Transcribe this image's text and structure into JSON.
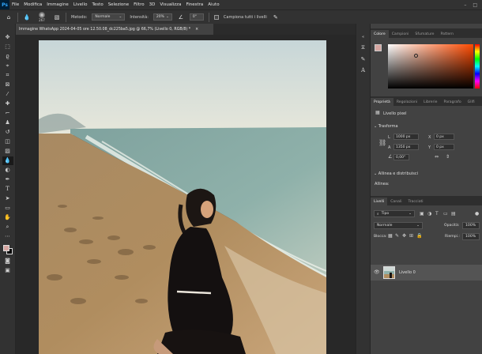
{
  "app": {
    "logo": "Ps",
    "window_buttons": [
      "–",
      "□"
    ]
  },
  "menu": [
    "File",
    "Modifica",
    "Immagine",
    "Livello",
    "Testo",
    "Selezione",
    "Filtro",
    "3D",
    "Visualizza",
    "Finestra",
    "Aiuto"
  ],
  "options": {
    "brush_size": "267",
    "metodo_label": "Metodo:",
    "metodo_value": "Normale",
    "intensita_label": "Intensità:",
    "intensita_value": "20%",
    "angle_value": "0°",
    "sample_all_label": "Campiona tutti i livelli"
  },
  "document": {
    "tab_title": "Immagine WhatsApp 2024-04-05 ore 12.50.08_dc225ba5.jpg @ 66,7% (Livello 0, RGB/8) *",
    "close": "×"
  },
  "colors": {
    "foreground": "#d6a6a1",
    "background": "#000000",
    "picker_hue": "#ff4a00"
  },
  "panels": {
    "color_tabs": [
      "Colore",
      "Campioni",
      "Sfumature",
      "Pattern"
    ],
    "props_tabs": [
      "Proprietà",
      "Regolazioni",
      "Librerie",
      "Paragrafo",
      "Glifi"
    ],
    "pixel_layer_label": "Livello pixel",
    "transform_label": "Trasforma",
    "L_label": "L",
    "L_value": "1000 px",
    "X_label": "X",
    "X_value": "0 px",
    "A_label": "A",
    "A_value": "1350 px",
    "Y_label": "Y",
    "Y_value": "0 px",
    "angle_value": "0,00°",
    "align_label": "Allinea e distribuisci",
    "align_sub": "Allinea:",
    "layers_tabs": [
      "Livelli",
      "Canali",
      "Tracciati"
    ],
    "filter_value": "Tipo",
    "blend_value": "Normale",
    "opacity_label": "Opacità:",
    "opacity_value": "100%",
    "lock_label": "Blocca:",
    "fill_label": "Riempi.:",
    "fill_value": "100%",
    "layer_name": "Livello 0"
  }
}
